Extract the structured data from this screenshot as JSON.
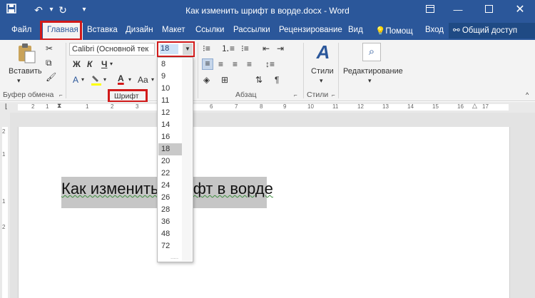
{
  "window": {
    "title": "Как изменить шрифт в ворде.docx - Word",
    "quick_access": {
      "save_icon": "save-icon",
      "undo_icon": "undo-icon",
      "redo_icon": "redo-icon",
      "customize_icon": "chevron-down-icon"
    },
    "controls": {
      "ribbon_options": "ribbon-display-icon",
      "minimize": "minimize-icon",
      "maximize": "maximize-icon",
      "close": "close-icon"
    }
  },
  "tabs": [
    {
      "label": "Файл"
    },
    {
      "label": "Главная"
    },
    {
      "label": "Вставка"
    },
    {
      "label": "Дизайн"
    },
    {
      "label": "Макет"
    },
    {
      "label": "Ссылки"
    },
    {
      "label": "Рассылки"
    },
    {
      "label": "Рецензирование"
    },
    {
      "label": "Вид"
    }
  ],
  "tell_me": {
    "label": "Помощ"
  },
  "sign_in": {
    "label": "Вход"
  },
  "share": {
    "label": "Общий доступ"
  },
  "ribbon": {
    "clipboard": {
      "paste_label": "Вставить",
      "group_label": "Буфер обмена"
    },
    "font": {
      "font_name": "Calibri (Основной тек",
      "font_size": "18",
      "bold": "Ж",
      "italic": "К",
      "underline": "Ч",
      "font_color_glyph": "A",
      "case_glyph": "Aa",
      "group_label": "Шрифт"
    },
    "paragraph": {
      "group_label": "Абзац",
      "pilcrow": "¶"
    },
    "styles": {
      "label": "Стили",
      "group_label": "Стили"
    },
    "editing": {
      "label": "Редактирование"
    }
  },
  "ruler": {
    "numbers": [
      "2",
      "1",
      "1",
      "2",
      "3",
      "4",
      "5",
      "6",
      "7",
      "8",
      "9",
      "10",
      "11",
      "12",
      "13",
      "14",
      "15",
      "16",
      "17"
    ]
  },
  "vruler": {
    "numbers": [
      "2",
      "1",
      "1",
      "2"
    ]
  },
  "document": {
    "text": "Как изменить шрифт в ворде"
  },
  "size_dropdown": {
    "options": [
      "8",
      "9",
      "10",
      "11",
      "12",
      "14",
      "16",
      "18",
      "20",
      "22",
      "24",
      "26",
      "28",
      "36",
      "48",
      "72"
    ],
    "selected": "18",
    "grip": "....."
  }
}
